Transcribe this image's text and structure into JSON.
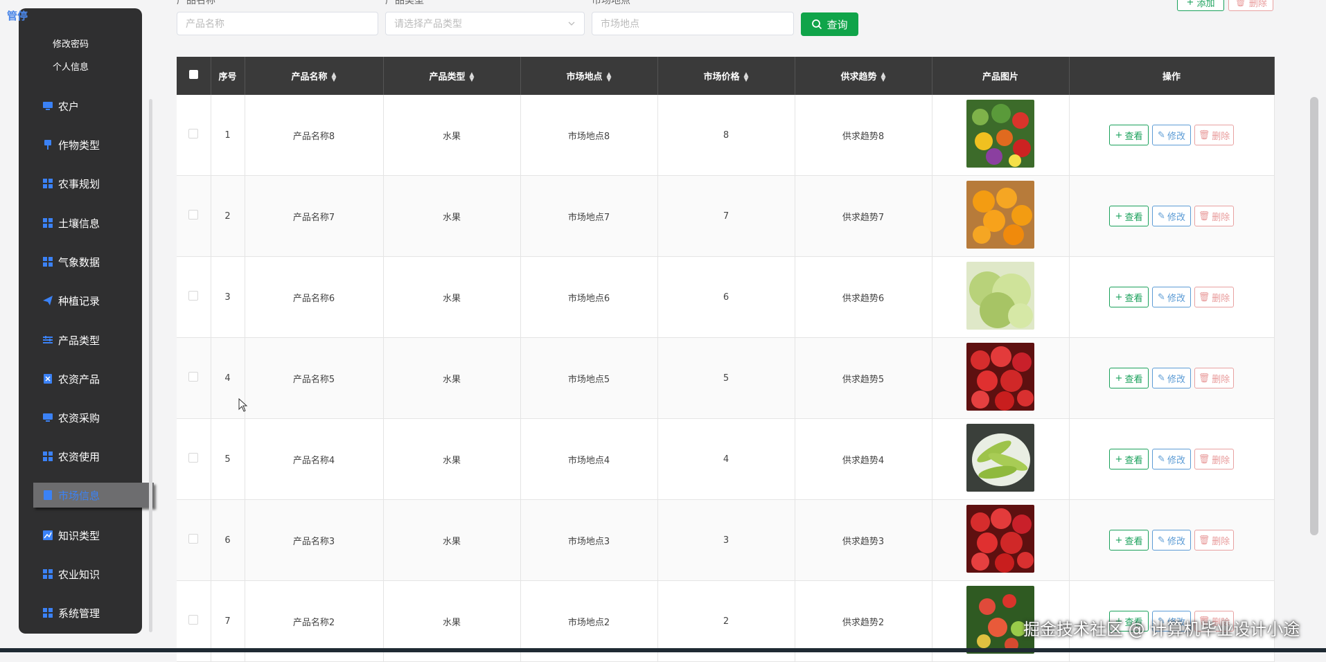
{
  "sidebar": {
    "brand": "管停",
    "sub_links": [
      "修改密码",
      "个人信息"
    ],
    "items": [
      {
        "label": "农户",
        "icon": "monitor-icon"
      },
      {
        "label": "作物类型",
        "icon": "pin-icon"
      },
      {
        "label": "农事规划",
        "icon": "grid-icon"
      },
      {
        "label": "土壤信息",
        "icon": "grid-icon"
      },
      {
        "label": "气象数据",
        "icon": "grid-icon"
      },
      {
        "label": "种植记录",
        "icon": "send-icon"
      },
      {
        "label": "产品类型",
        "icon": "sliders-icon"
      },
      {
        "label": "农资产品",
        "icon": "document-icon"
      },
      {
        "label": "农资采购",
        "icon": "monitor-icon"
      },
      {
        "label": "农资使用",
        "icon": "grid-icon"
      },
      {
        "label": "市场信息",
        "icon": "list-icon",
        "active": true
      },
      {
        "label": "知识类型",
        "icon": "chart-icon"
      },
      {
        "label": "农业知识",
        "icon": "grid-icon"
      },
      {
        "label": "系统管理",
        "icon": "grid-icon"
      }
    ]
  },
  "search": {
    "labels": [
      "产品名称",
      "产品类型",
      "市场地点"
    ],
    "name_placeholder": "产品名称",
    "type_placeholder": "请选择产品类型",
    "location_placeholder": "市场地点",
    "button": "查询"
  },
  "toolbar": {
    "add": "添加",
    "delete": "删除"
  },
  "table": {
    "headers": [
      "序号",
      "产品名称",
      "产品类型",
      "市场地点",
      "市场价格",
      "供求趋势",
      "产品图片",
      "操作"
    ],
    "rows": [
      {
        "no": "1",
        "name": "产品名称8",
        "type": "水果",
        "location": "市场地点8",
        "price": "8",
        "trend": "供求趋势8",
        "image": "mixed-vegetables"
      },
      {
        "no": "2",
        "name": "产品名称7",
        "type": "水果",
        "location": "市场地点7",
        "price": "7",
        "trend": "供求趋势7",
        "image": "loquats"
      },
      {
        "no": "3",
        "name": "产品名称6",
        "type": "水果",
        "location": "市场地点6",
        "price": "6",
        "trend": "供求趋势6",
        "image": "lettuce"
      },
      {
        "no": "4",
        "name": "产品名称5",
        "type": "水果",
        "location": "市场地点5",
        "price": "5",
        "trend": "供求趋势5",
        "image": "strawberries"
      },
      {
        "no": "5",
        "name": "产品名称4",
        "type": "水果",
        "location": "市场地点4",
        "price": "4",
        "trend": "供求趋势4",
        "image": "edamame"
      },
      {
        "no": "6",
        "name": "产品名称3",
        "type": "水果",
        "location": "市场地点3",
        "price": "3",
        "trend": "供求趋势3",
        "image": "strawberries"
      },
      {
        "no": "7",
        "name": "产品名称2",
        "type": "水果",
        "location": "市场地点2",
        "price": "2",
        "trend": "供求趋势2",
        "image": "tomatoes"
      }
    ],
    "actions": {
      "view": "查看",
      "edit": "修改",
      "delete": "删除"
    }
  },
  "watermark": "掘金技术社区 @ 计算机毕业设计小途",
  "colors": {
    "sidebar_bg": "#2f2f30",
    "header_bg": "#3a3a3a",
    "accent_blue": "#3b82f6",
    "search_green": "#10a44a"
  }
}
